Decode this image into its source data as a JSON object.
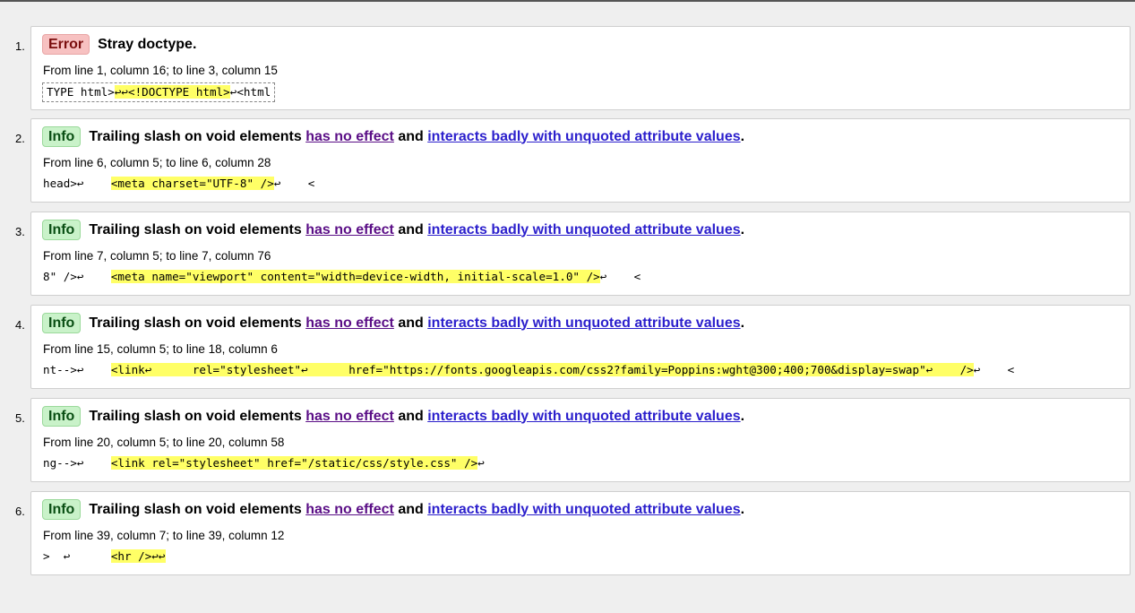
{
  "messages": [
    {
      "number": "1.",
      "type": "error",
      "badge": "Error",
      "title": "Stray doctype.",
      "location": "From line 1, column 16; to line 3, column 15",
      "extract_before": "TYPE html>",
      "extract_highlight": "↩↩<!DOCTYPE html>",
      "extract_after": "↩<html"
    },
    {
      "number": "2.",
      "type": "info",
      "badge": "Info",
      "title": "Trailing slash on void elements",
      "link1": "has no effect",
      "mid": "and",
      "link2": "interacts badly with unquoted attribute values",
      "end": ".",
      "location": "From line 6, column 5; to line 6, column 28",
      "extract_before": "head>↩    ",
      "extract_highlight": "<meta charset=\"UTF-8\" />",
      "extract_after": "↩    <"
    },
    {
      "number": "3.",
      "type": "info",
      "badge": "Info",
      "title": "Trailing slash on void elements",
      "link1": "has no effect",
      "mid": "and",
      "link2": "interacts badly with unquoted attribute values",
      "end": ".",
      "location": "From line 7, column 5; to line 7, column 76",
      "extract_before": "8\" />↩    ",
      "extract_highlight": "<meta name=\"viewport\" content=\"width=device-width, initial-scale=1.0\" />",
      "extract_after": "↩    <"
    },
    {
      "number": "4.",
      "type": "info",
      "badge": "Info",
      "title": "Trailing slash on void elements",
      "link1": "has no effect",
      "mid": "and",
      "link2": "interacts badly with unquoted attribute values",
      "end": ".",
      "location": "From line 15, column 5; to line 18, column 6",
      "extract_before": "nt-->↩    ",
      "extract_highlight": "<link↩      rel=\"stylesheet\"↩      href=\"https://fonts.googleapis.com/css2?family=Poppins:wght@300;400;700&display=swap\"↩    />",
      "extract_after": "↩    <"
    },
    {
      "number": "5.",
      "type": "info",
      "badge": "Info",
      "title": "Trailing slash on void elements",
      "link1": "has no effect",
      "mid": "and",
      "link2": "interacts badly with unquoted attribute values",
      "end": ".",
      "location": "From line 20, column 5; to line 20, column 58",
      "extract_before": "ng-->↩    ",
      "extract_highlight": "<link rel=\"stylesheet\" href=\"/static/css/style.css\" />",
      "extract_after": "↩"
    },
    {
      "number": "6.",
      "type": "info",
      "badge": "Info",
      "title": "Trailing slash on void elements",
      "link1": "has no effect",
      "mid": "and",
      "link2": "interacts badly with unquoted attribute values",
      "end": ".",
      "location": "From line 39, column 7; to line 39, column 12",
      "extract_before": ">  ↩      ",
      "extract_highlight": "<hr />↩↩",
      "extract_after": ""
    }
  ],
  "colors": {
    "error_badge_bg": "#f7c1c1",
    "info_badge_bg": "#c9f2c9",
    "highlight": "#ffff66",
    "link_visited": "#5a0e86",
    "link_unvisited": "#2b1fcc"
  }
}
